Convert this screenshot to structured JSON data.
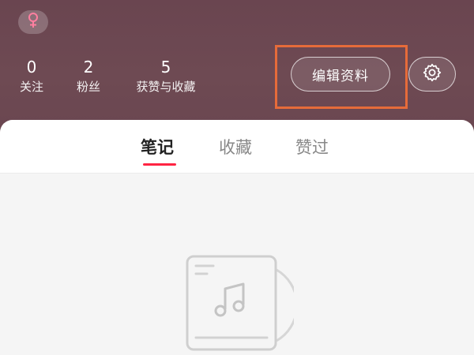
{
  "profile": {
    "gender_icon": "female-symbol-icon",
    "stats": {
      "following": {
        "count": "0",
        "label": "关注"
      },
      "fans": {
        "count": "2",
        "label": "粉丝"
      },
      "likes": {
        "count": "5",
        "label": "获赞与收藏"
      }
    },
    "edit_button_label": "编辑资料",
    "settings_icon": "gear-icon"
  },
  "colors": {
    "header_bg": "#6e4a53",
    "highlight_border": "#e66b3a",
    "tab_active_underline": "#ff2442",
    "gender_icon": "#ff7fa0"
  },
  "tabs": [
    {
      "label": "笔记",
      "active": true
    },
    {
      "label": "收藏",
      "active": false
    },
    {
      "label": "赞过",
      "active": false
    }
  ],
  "empty_state": {
    "icon": "music-album-icon"
  }
}
